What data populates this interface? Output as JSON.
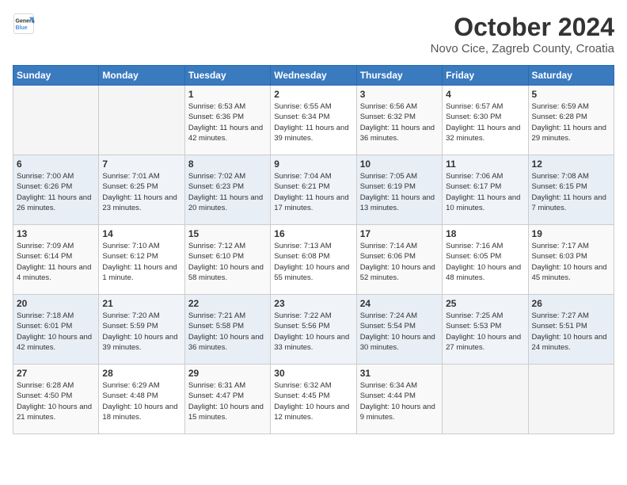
{
  "header": {
    "logo_general": "General",
    "logo_blue": "Blue",
    "month": "October 2024",
    "location": "Novo Cice, Zagreb County, Croatia"
  },
  "weekdays": [
    "Sunday",
    "Monday",
    "Tuesday",
    "Wednesday",
    "Thursday",
    "Friday",
    "Saturday"
  ],
  "weeks": [
    [
      {
        "day": "",
        "info": ""
      },
      {
        "day": "",
        "info": ""
      },
      {
        "day": "1",
        "info": "Sunrise: 6:53 AM\nSunset: 6:36 PM\nDaylight: 11 hours and 42 minutes."
      },
      {
        "day": "2",
        "info": "Sunrise: 6:55 AM\nSunset: 6:34 PM\nDaylight: 11 hours and 39 minutes."
      },
      {
        "day": "3",
        "info": "Sunrise: 6:56 AM\nSunset: 6:32 PM\nDaylight: 11 hours and 36 minutes."
      },
      {
        "day": "4",
        "info": "Sunrise: 6:57 AM\nSunset: 6:30 PM\nDaylight: 11 hours and 32 minutes."
      },
      {
        "day": "5",
        "info": "Sunrise: 6:59 AM\nSunset: 6:28 PM\nDaylight: 11 hours and 29 minutes."
      }
    ],
    [
      {
        "day": "6",
        "info": "Sunrise: 7:00 AM\nSunset: 6:26 PM\nDaylight: 11 hours and 26 minutes."
      },
      {
        "day": "7",
        "info": "Sunrise: 7:01 AM\nSunset: 6:25 PM\nDaylight: 11 hours and 23 minutes."
      },
      {
        "day": "8",
        "info": "Sunrise: 7:02 AM\nSunset: 6:23 PM\nDaylight: 11 hours and 20 minutes."
      },
      {
        "day": "9",
        "info": "Sunrise: 7:04 AM\nSunset: 6:21 PM\nDaylight: 11 hours and 17 minutes."
      },
      {
        "day": "10",
        "info": "Sunrise: 7:05 AM\nSunset: 6:19 PM\nDaylight: 11 hours and 13 minutes."
      },
      {
        "day": "11",
        "info": "Sunrise: 7:06 AM\nSunset: 6:17 PM\nDaylight: 11 hours and 10 minutes."
      },
      {
        "day": "12",
        "info": "Sunrise: 7:08 AM\nSunset: 6:15 PM\nDaylight: 11 hours and 7 minutes."
      }
    ],
    [
      {
        "day": "13",
        "info": "Sunrise: 7:09 AM\nSunset: 6:14 PM\nDaylight: 11 hours and 4 minutes."
      },
      {
        "day": "14",
        "info": "Sunrise: 7:10 AM\nSunset: 6:12 PM\nDaylight: 11 hours and 1 minute."
      },
      {
        "day": "15",
        "info": "Sunrise: 7:12 AM\nSunset: 6:10 PM\nDaylight: 10 hours and 58 minutes."
      },
      {
        "day": "16",
        "info": "Sunrise: 7:13 AM\nSunset: 6:08 PM\nDaylight: 10 hours and 55 minutes."
      },
      {
        "day": "17",
        "info": "Sunrise: 7:14 AM\nSunset: 6:06 PM\nDaylight: 10 hours and 52 minutes."
      },
      {
        "day": "18",
        "info": "Sunrise: 7:16 AM\nSunset: 6:05 PM\nDaylight: 10 hours and 48 minutes."
      },
      {
        "day": "19",
        "info": "Sunrise: 7:17 AM\nSunset: 6:03 PM\nDaylight: 10 hours and 45 minutes."
      }
    ],
    [
      {
        "day": "20",
        "info": "Sunrise: 7:18 AM\nSunset: 6:01 PM\nDaylight: 10 hours and 42 minutes."
      },
      {
        "day": "21",
        "info": "Sunrise: 7:20 AM\nSunset: 5:59 PM\nDaylight: 10 hours and 39 minutes."
      },
      {
        "day": "22",
        "info": "Sunrise: 7:21 AM\nSunset: 5:58 PM\nDaylight: 10 hours and 36 minutes."
      },
      {
        "day": "23",
        "info": "Sunrise: 7:22 AM\nSunset: 5:56 PM\nDaylight: 10 hours and 33 minutes."
      },
      {
        "day": "24",
        "info": "Sunrise: 7:24 AM\nSunset: 5:54 PM\nDaylight: 10 hours and 30 minutes."
      },
      {
        "day": "25",
        "info": "Sunrise: 7:25 AM\nSunset: 5:53 PM\nDaylight: 10 hours and 27 minutes."
      },
      {
        "day": "26",
        "info": "Sunrise: 7:27 AM\nSunset: 5:51 PM\nDaylight: 10 hours and 24 minutes."
      }
    ],
    [
      {
        "day": "27",
        "info": "Sunrise: 6:28 AM\nSunset: 4:50 PM\nDaylight: 10 hours and 21 minutes."
      },
      {
        "day": "28",
        "info": "Sunrise: 6:29 AM\nSunset: 4:48 PM\nDaylight: 10 hours and 18 minutes."
      },
      {
        "day": "29",
        "info": "Sunrise: 6:31 AM\nSunset: 4:47 PM\nDaylight: 10 hours and 15 minutes."
      },
      {
        "day": "30",
        "info": "Sunrise: 6:32 AM\nSunset: 4:45 PM\nDaylight: 10 hours and 12 minutes."
      },
      {
        "day": "31",
        "info": "Sunrise: 6:34 AM\nSunset: 4:44 PM\nDaylight: 10 hours and 9 minutes."
      },
      {
        "day": "",
        "info": ""
      },
      {
        "day": "",
        "info": ""
      }
    ]
  ]
}
